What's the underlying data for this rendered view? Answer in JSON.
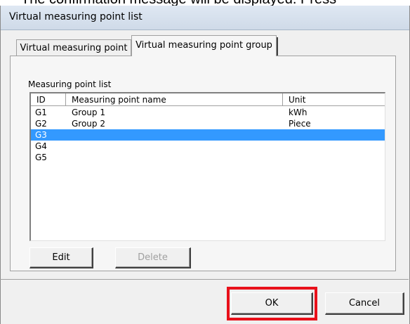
{
  "background_caption": "The confirmation message will be displayed. Press",
  "window": {
    "title": "Virtual measuring point list"
  },
  "tabs": [
    {
      "label": "Virtual measuring point",
      "active": false
    },
    {
      "label": "Virtual measuring point group",
      "active": true
    }
  ],
  "group": {
    "label": "Measuring point list"
  },
  "list": {
    "columns": [
      "ID",
      "Measuring point name",
      "Unit"
    ],
    "rows": [
      {
        "id": "G1",
        "name": "Group 1",
        "unit": "kWh",
        "selected": false
      },
      {
        "id": "G2",
        "name": "Group 2",
        "unit": "Piece",
        "selected": false
      },
      {
        "id": "G3",
        "name": "",
        "unit": "",
        "selected": true
      },
      {
        "id": "G4",
        "name": "",
        "unit": "",
        "selected": false
      },
      {
        "id": "G5",
        "name": "",
        "unit": "",
        "selected": false
      }
    ]
  },
  "buttons": {
    "edit": "Edit",
    "delete": "Delete",
    "ok": "OK",
    "cancel": "Cancel"
  },
  "colors": {
    "selection": "#3399ff",
    "highlight_box": "#e8101a"
  }
}
